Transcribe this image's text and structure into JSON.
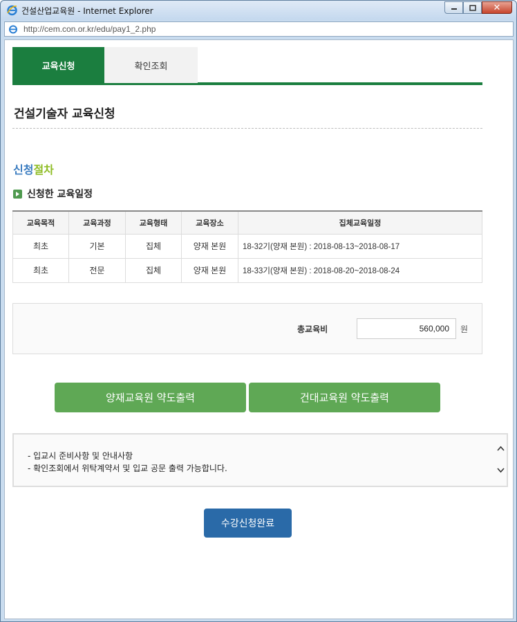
{
  "window": {
    "title": "건설산업교육원 - Internet Explorer",
    "url": "http://cem.con.or.kr/edu/pay1_2.php"
  },
  "tabs": [
    {
      "label": "교육신청",
      "active": true
    },
    {
      "label": "확인조회",
      "active": false
    }
  ],
  "page_title": "건설기술자 교육신청",
  "section": {
    "title_part1": "신청",
    "title_part2": "절차"
  },
  "schedule": {
    "subtitle": "신청한 교육일정",
    "columns": [
      "교육목적",
      "교육과정",
      "교육형태",
      "교육장소",
      "집체교육일정"
    ],
    "rows": [
      [
        "최초",
        "기본",
        "집체",
        "양재 본원",
        "18-32기(양재 본원) : 2018-08-13~2018-08-17"
      ],
      [
        "최초",
        "전문",
        "집체",
        "양재 본원",
        "18-33기(양재 본원) : 2018-08-20~2018-08-24"
      ]
    ]
  },
  "fee": {
    "label": "총교육비",
    "value": "560,000",
    "unit": "원"
  },
  "buttons": {
    "map_yangjae": "양재교육원 약도출력",
    "map_kondae": "건대교육원 약도출력",
    "submit": "수강신청완료"
  },
  "notice": {
    "lines": [
      "- 입교시 준비사항 및 안내사항",
      "- 확인조회에서 위탁계약서 및 입교 공문 출력 가능합니다."
    ]
  },
  "colors": {
    "tab_active": "#1b7e3f",
    "section_blue": "#3a7cc0",
    "section_green": "#8fbd26",
    "map_button": "#5fa855",
    "submit_button": "#2a6aa8"
  }
}
